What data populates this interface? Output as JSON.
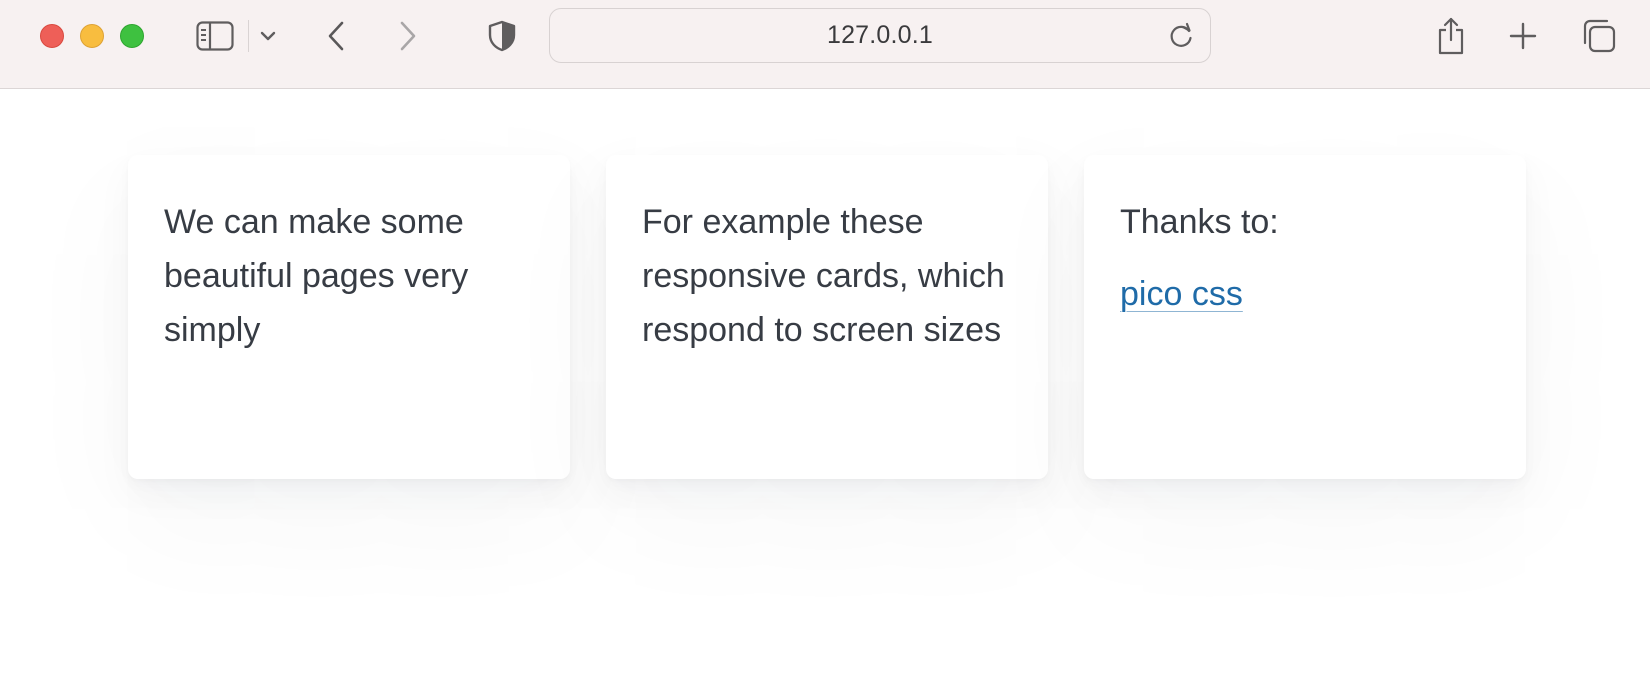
{
  "browser": {
    "url": "127.0.0.1",
    "icons": {
      "close": "close-window",
      "minimize": "minimize-window",
      "maximize": "maximize-window",
      "sidebar": "sidebar-icon",
      "sidebar_menu": "chevron-down-icon",
      "back": "chevron-left-icon",
      "forward": "chevron-right-icon",
      "privacy": "shield-icon",
      "reload": "reload-icon",
      "share": "share-icon",
      "new_tab": "plus-icon",
      "tab_overview": "tabs-icon"
    },
    "colors": {
      "toolbar_bg": "#f7f1f1",
      "close": "#ee5f58",
      "minimize": "#f8bd3f",
      "maximize": "#3ec140"
    }
  },
  "cards": [
    {
      "text": "We can make some beautiful pages very simply"
    },
    {
      "text": "For example these responsive cards, which respond to screen sizes"
    },
    {
      "text": "Thanks to:",
      "link_text": "pico css"
    }
  ],
  "colors": {
    "text": "#373c44",
    "link": "#1f6ba8"
  }
}
